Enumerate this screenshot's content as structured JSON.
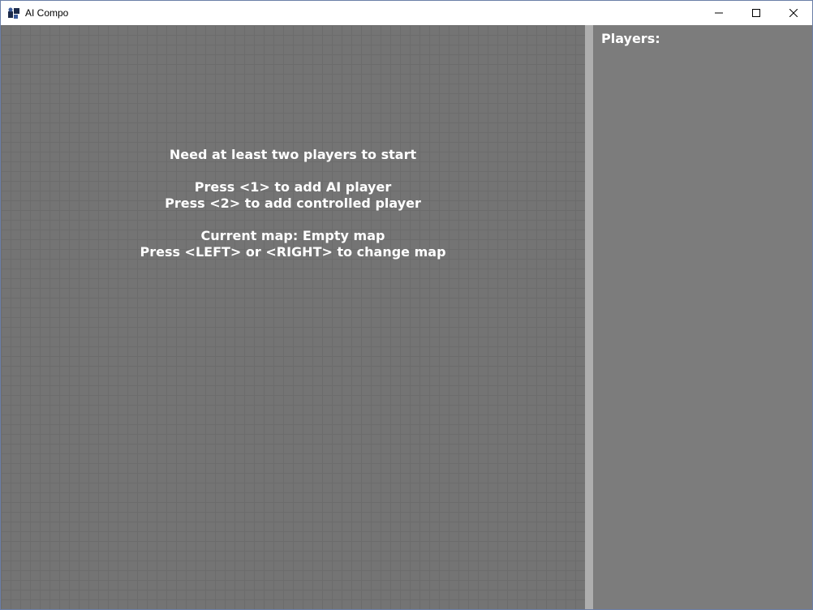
{
  "window": {
    "title": "AI Compo",
    "app_icon": "app-logo-icon",
    "controls": {
      "minimize_icon": "minimize-icon",
      "maximize_icon": "maximize-icon",
      "close_icon": "close-icon"
    }
  },
  "game": {
    "messages": [
      "Need at least two players to start",
      "",
      "Press <1> to add AI player",
      "Press <2> to add controlled player",
      "",
      "Current map: Empty map",
      "Press <LEFT> or <RIGHT> to change map"
    ]
  },
  "sidebar": {
    "heading": "Players:",
    "players": []
  },
  "colors": {
    "grid_background": "#747474",
    "grid_lines": "#6c6c6c",
    "divider": "#aeaeae",
    "sidebar_background": "#7c7c7c",
    "text": "#ffffff"
  }
}
